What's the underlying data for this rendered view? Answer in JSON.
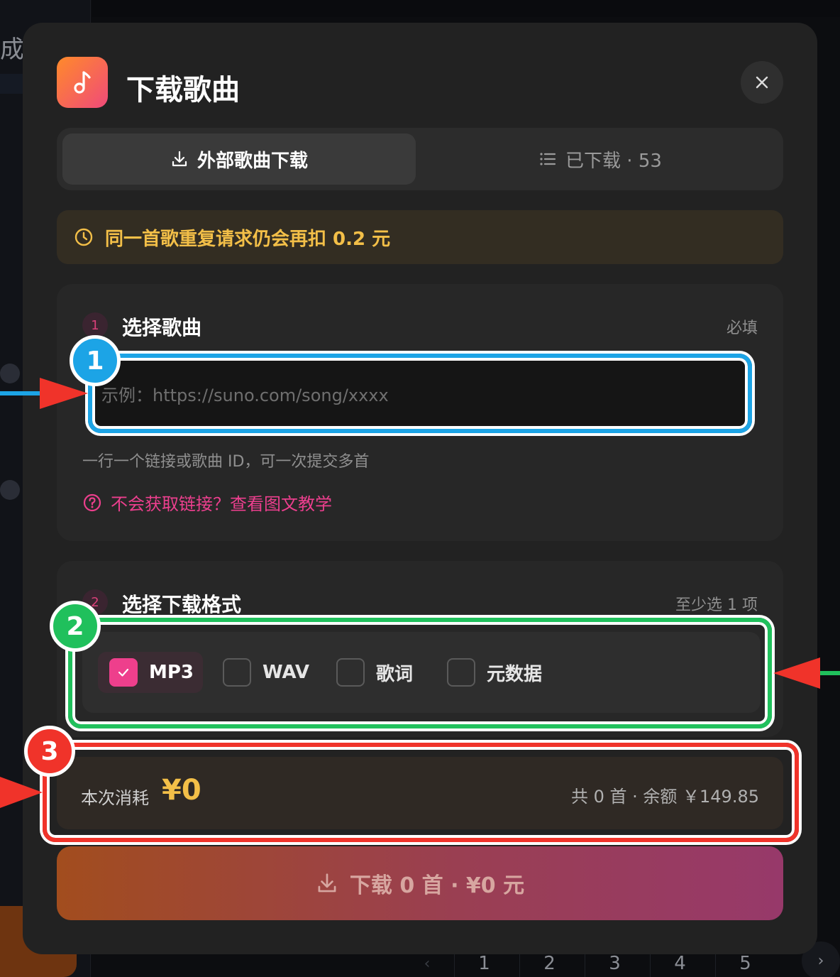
{
  "background": {
    "left_char": "成",
    "pagination": [
      "1",
      "2",
      "3",
      "4",
      "5"
    ]
  },
  "modal": {
    "title": "下载歌曲",
    "icon": "music-note-icon"
  },
  "tabs": [
    {
      "label": "外部歌曲下载",
      "icon": "download-icon",
      "active": true
    },
    {
      "label": "已下载 · 53",
      "icon": "list-icon",
      "active": false
    }
  ],
  "notice": {
    "text": "同一首歌重复请求仍会再扣 0.2 元",
    "icon": "clock-icon"
  },
  "step1": {
    "number": "1",
    "title": "选择歌曲",
    "hint": "必填",
    "input_placeholder": "示例：https://suno.com/song/xxxx",
    "helper": "一行一个链接或歌曲 ID，可一次提交多首",
    "help_link": "不会获取链接？查看图文教学"
  },
  "step2": {
    "number": "2",
    "title": "选择下载格式",
    "hint": "至少选 1 项",
    "options": [
      {
        "label": "MP3",
        "checked": true
      },
      {
        "label": "WAV",
        "checked": false
      },
      {
        "label": "歌词",
        "checked": false
      },
      {
        "label": "元数据",
        "checked": false
      }
    ]
  },
  "cost": {
    "label": "本次消耗",
    "value": "¥0",
    "info": "共 0 首 · 余额 ￥149.85"
  },
  "download_button": {
    "label": "下载 0 首 · ¥0 元"
  },
  "annotations": {
    "badges": [
      "1",
      "2",
      "3"
    ],
    "colors": {
      "blue": "#1ca4e6",
      "green": "#20c05c",
      "red": "#f0332a"
    }
  },
  "colors": {
    "accent_pink": "#ee3f8c",
    "warning_yellow": "#f3bf48",
    "modal_bg": "#222222"
  }
}
